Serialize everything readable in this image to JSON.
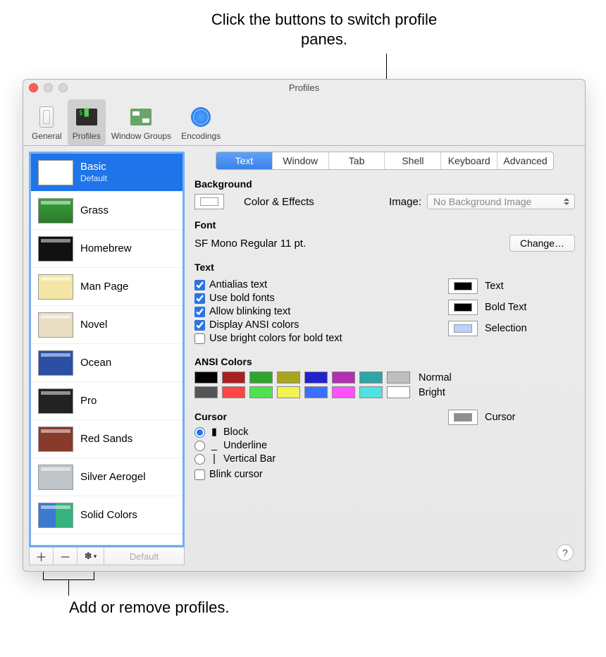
{
  "callouts": {
    "top": "Click the buttons to switch profile panes.",
    "bottom": "Add or remove profiles."
  },
  "window": {
    "title": "Profiles"
  },
  "toolbar": {
    "items": [
      {
        "label": "General"
      },
      {
        "label": "Profiles"
      },
      {
        "label": "Window Groups"
      },
      {
        "label": "Encodings"
      }
    ]
  },
  "profiles": [
    {
      "name": "Basic",
      "sub": "Default",
      "selected": true,
      "thumb": "t-basic"
    },
    {
      "name": "Grass",
      "thumb": "t-grass"
    },
    {
      "name": "Homebrew",
      "thumb": "t-homebrew"
    },
    {
      "name": "Man Page",
      "thumb": "t-manpage"
    },
    {
      "name": "Novel",
      "thumb": "t-novel"
    },
    {
      "name": "Ocean",
      "thumb": "t-ocean"
    },
    {
      "name": "Pro",
      "thumb": "t-pro"
    },
    {
      "name": "Red Sands",
      "thumb": "t-redsands"
    },
    {
      "name": "Silver Aerogel",
      "thumb": "t-silver"
    },
    {
      "name": "Solid Colors",
      "thumb": "t-solid"
    }
  ],
  "sidebar_buttons": {
    "default": "Default"
  },
  "tabs": [
    "Text",
    "Window",
    "Tab",
    "Shell",
    "Keyboard",
    "Advanced"
  ],
  "sections": {
    "background": {
      "title": "Background",
      "color_label": "Color & Effects",
      "image_label": "Image:",
      "image_value": "No Background Image"
    },
    "font": {
      "title": "Font",
      "value": "SF Mono Regular 11 pt.",
      "change": "Change…"
    },
    "text": {
      "title": "Text",
      "opts": [
        {
          "label": "Antialias text",
          "checked": true
        },
        {
          "label": "Use bold fonts",
          "checked": true
        },
        {
          "label": "Allow blinking text",
          "checked": true
        },
        {
          "label": "Display ANSI colors",
          "checked": true
        },
        {
          "label": "Use bright colors for bold text",
          "checked": false
        }
      ],
      "swatches": [
        {
          "label": "Text",
          "color": "#000000"
        },
        {
          "label": "Bold Text",
          "color": "#000000"
        },
        {
          "label": "Selection",
          "color": "#b6d2ff"
        }
      ]
    },
    "ansi": {
      "title": "ANSI Colors",
      "normal_label": "Normal",
      "bright_label": "Bright",
      "normal": [
        "#000000",
        "#aa2020",
        "#2fa52f",
        "#aaa520",
        "#2222cc",
        "#b030b0",
        "#2fa5a5",
        "#bfbfbf"
      ],
      "bright": [
        "#555555",
        "#ff4545",
        "#4fe24f",
        "#f3f34f",
        "#3a6fff",
        "#ff4fff",
        "#4fe2e2",
        "#ffffff"
      ]
    },
    "cursor": {
      "title": "Cursor",
      "opts": [
        {
          "label": "Block",
          "glyph": "▮",
          "checked": true
        },
        {
          "label": "Underline",
          "glyph": "_",
          "checked": false
        },
        {
          "label": "Vertical Bar",
          "glyph": "|",
          "checked": false
        }
      ],
      "blink_label": "Blink cursor",
      "swatch_label": "Cursor",
      "swatch_color": "#8e8e8e"
    }
  }
}
